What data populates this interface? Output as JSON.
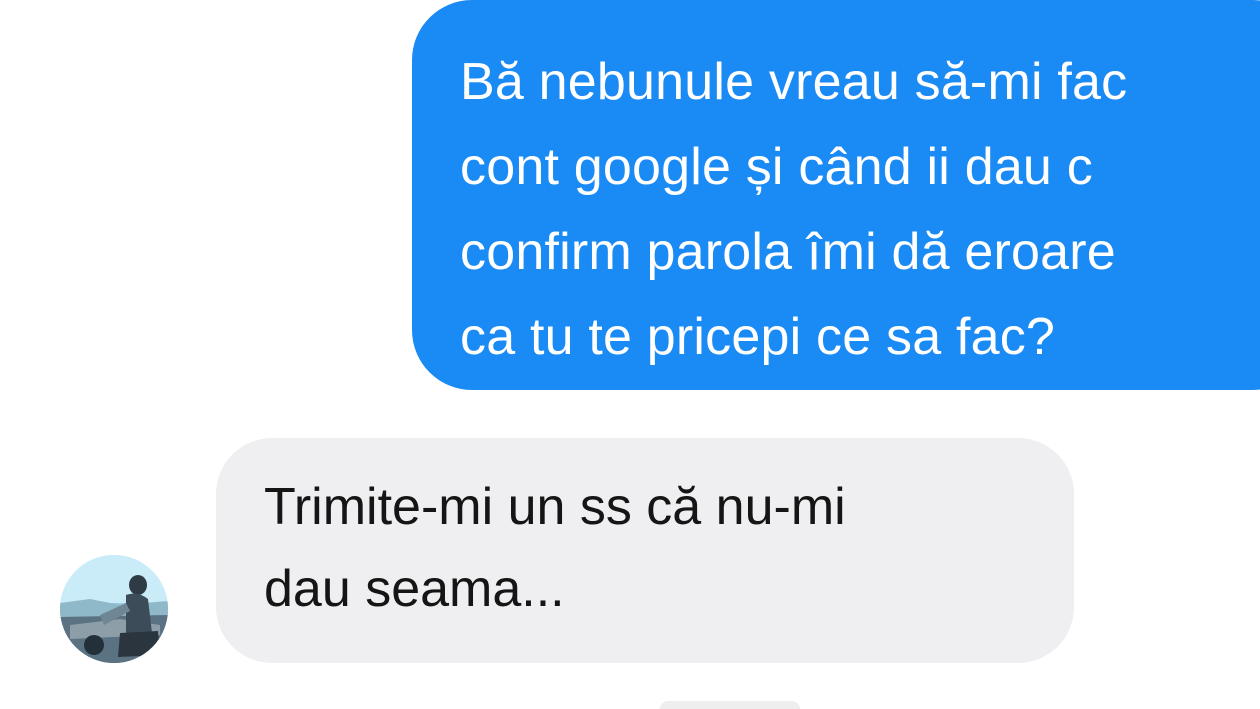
{
  "conversation": {
    "outgoing": {
      "lines": [
        "Bă nebunule vreau să-mi fac",
        "cont google și când ii dau c",
        "confirm parola îmi dă eroare",
        "ca tu te pricepi ce sa fac?"
      ]
    },
    "incoming": {
      "lines": [
        "Trimite-mi un ss că nu-mi",
        "dau seama..."
      ],
      "avatar_icon": "user-avatar-photo"
    }
  },
  "colors": {
    "outgoing_bubble": "#1a8af5",
    "incoming_bubble": "#efeff1",
    "background": "#ffffff"
  }
}
